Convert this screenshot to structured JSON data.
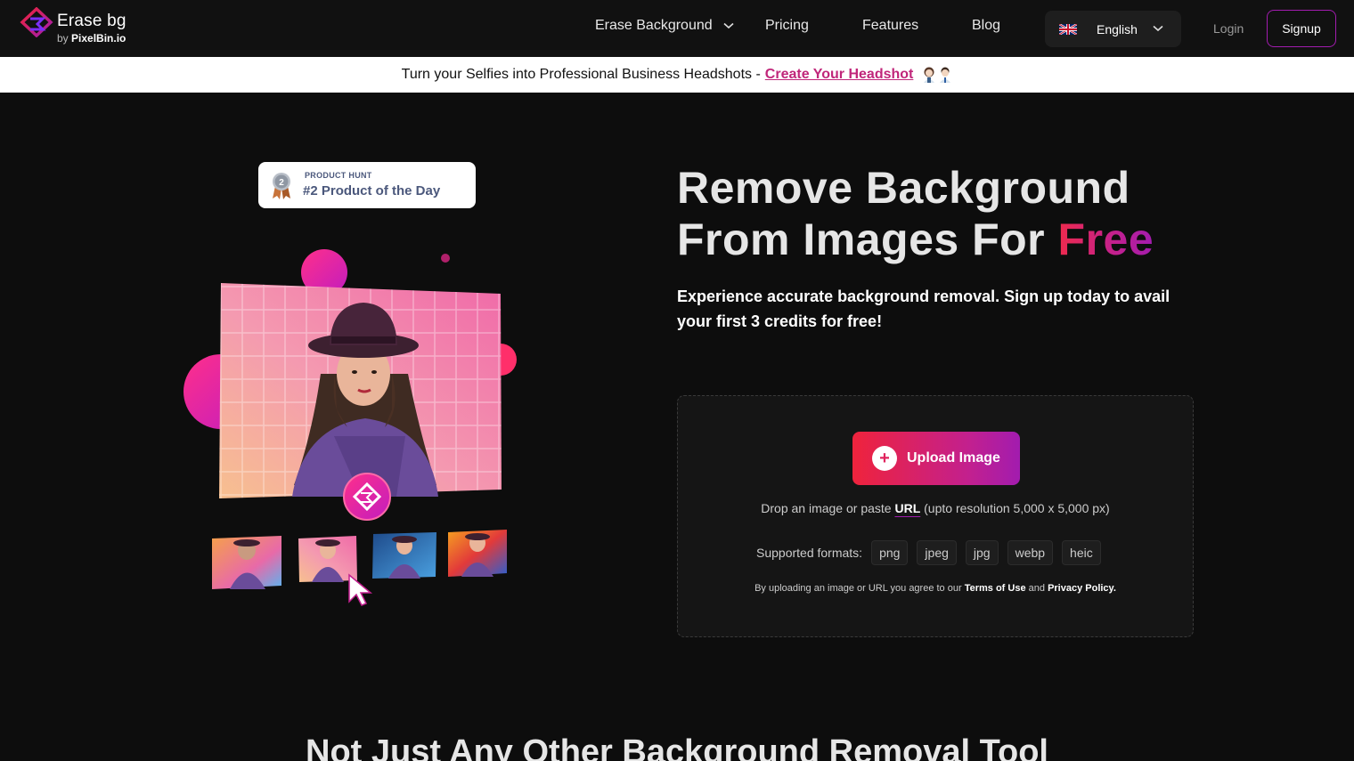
{
  "nav": {
    "logo_title": "Erase bg",
    "logo_by": "by",
    "logo_brand": "PixelBin.io",
    "items": [
      {
        "label": "Erase Background"
      },
      {
        "label": "Pricing"
      },
      {
        "label": "Features"
      },
      {
        "label": "Blog"
      }
    ],
    "language": "English",
    "login": "Login",
    "signup": "Signup"
  },
  "promo": {
    "text": "Turn your Selfies into Professional Business Headshots -",
    "link": "Create Your Headshot"
  },
  "badge": {
    "small": "PRODUCT HUNT",
    "big": "#2 Product of the Day",
    "medal_number": "2"
  },
  "hero": {
    "title_line1": "Remove Background",
    "title_line2": "From Images For",
    "title_highlight": "Free",
    "subtitle": "Experience accurate background removal. Sign up today to avail your first 3 credits for free!"
  },
  "upload": {
    "button_label": "Upload Image",
    "drop_prefix": "Drop an image or paste",
    "drop_url": "URL",
    "drop_suffix": "(upto resolution 5,000 x 5,000 px)",
    "formats_label": "Supported formats:",
    "formats": [
      "png",
      "jpeg",
      "jpg",
      "webp",
      "heic"
    ],
    "terms_prefix": "By uploading an image or URL you agree to our",
    "terms_link": "Terms of Use",
    "terms_and": "and",
    "privacy_link": "Privacy Policy."
  },
  "section_title": "Not Just Any Other Background Removal Tool",
  "colors": {
    "accent_start": "#ef233c",
    "accent_end": "#a21caf",
    "background": "#0d0d0d"
  }
}
